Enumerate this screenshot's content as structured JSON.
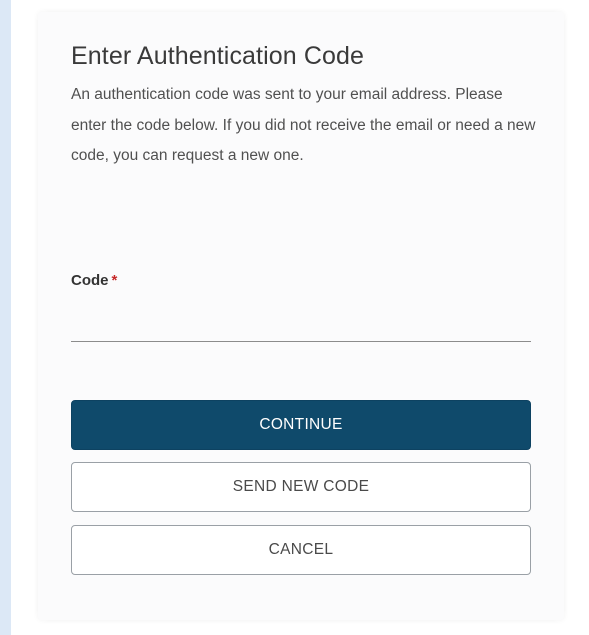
{
  "form": {
    "title": "Enter Authentication Code",
    "description": "An authentication code was sent to your email address. Please enter the code below. If you did not receive the email or need a new code, you can request a new one.",
    "code_label": "Code",
    "required_marker": "*",
    "code_value": ""
  },
  "buttons": {
    "continue_label": "CONTINUE",
    "send_new_code_label": "SEND NEW CODE",
    "cancel_label": "CANCEL"
  },
  "colors": {
    "primary": "#0f4a6b",
    "required": "#c62828",
    "left_strip": "#dce8f6"
  }
}
